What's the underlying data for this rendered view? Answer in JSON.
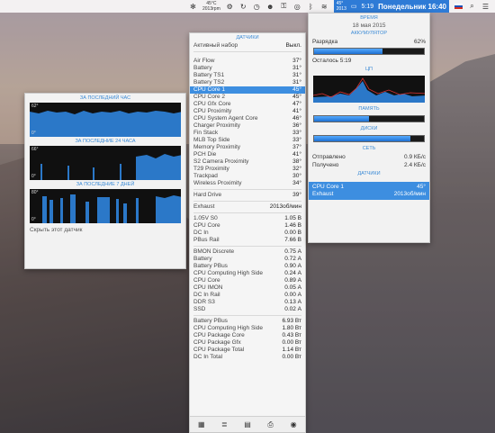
{
  "menubar": {
    "cpu_temp": "45°C",
    "rpm": "2013rpm",
    "status_temp": "45°",
    "status_rpm": "2013",
    "status_time": "5:19",
    "clock": "Понедельник 16:40"
  },
  "history": {
    "sections": [
      {
        "title": "ЗА ПОСЛЕДНИЙ ЧАС",
        "max": "62°",
        "min": "0°"
      },
      {
        "title": "ЗА ПОСЛЕДНИЕ 24 ЧАСА",
        "max": "66°",
        "min": "0°"
      },
      {
        "title": "ЗА ПОСЛЕДНИЕ 7 ДНЕЙ",
        "max": "80°",
        "min": "0°"
      }
    ],
    "hide_label": "Скрыть этот датчик"
  },
  "sensors": {
    "title": "ДАТЧИКИ",
    "active_set_label": "Активный набор",
    "active_set_value": "Выкл.",
    "temps": [
      {
        "name": "Air Flow",
        "value": "37°"
      },
      {
        "name": "Battery",
        "value": "31°"
      },
      {
        "name": "Battery TS1",
        "value": "31°"
      },
      {
        "name": "Battery TS2",
        "value": "31°"
      },
      {
        "name": "CPU Core 1",
        "value": "45°"
      },
      {
        "name": "CPU Core 2",
        "value": "45°"
      },
      {
        "name": "CPU Gfx Core",
        "value": "47°"
      },
      {
        "name": "CPU Proximity",
        "value": "41°"
      },
      {
        "name": "CPU System Agent Core",
        "value": "46°"
      },
      {
        "name": "Charger Proximity",
        "value": "36°"
      },
      {
        "name": "Fin Stack",
        "value": "33°"
      },
      {
        "name": "MLB Top Side",
        "value": "33°"
      },
      {
        "name": "Memory Proximity",
        "value": "37°"
      },
      {
        "name": "PCH Die",
        "value": "41°"
      },
      {
        "name": "S2 Camera Proximity",
        "value": "38°"
      },
      {
        "name": "T29 Proximity",
        "value": "32°"
      },
      {
        "name": "Trackpad",
        "value": "30°"
      },
      {
        "name": "Wireless Proximity",
        "value": "34°"
      }
    ],
    "drive": {
      "name": "Hard Drive",
      "value": "39°"
    },
    "fan": {
      "name": "Exhaust",
      "value": "2013об/мин"
    },
    "voltages": [
      {
        "name": "1.05V S0",
        "value": "1.05 В"
      },
      {
        "name": "CPU Core",
        "value": "1.46 В"
      },
      {
        "name": "DC In",
        "value": "0.00 В"
      },
      {
        "name": "PBus Rail",
        "value": "7.66 В"
      }
    ],
    "currents": [
      {
        "name": "BMON Discrete",
        "value": "0.75 А"
      },
      {
        "name": "Battery",
        "value": "0.72 А"
      },
      {
        "name": "Battery PBus",
        "value": "0.90 А"
      },
      {
        "name": "CPU Computing High Side",
        "value": "0.24 А"
      },
      {
        "name": "CPU Core",
        "value": "0.89 А"
      },
      {
        "name": "CPU IMON",
        "value": "0.05 А"
      },
      {
        "name": "DC In Rail",
        "value": "0.00 А"
      },
      {
        "name": "DDR S3",
        "value": "0.13 А"
      },
      {
        "name": "SSD",
        "value": "0.02 А"
      }
    ],
    "power": [
      {
        "name": "Battery PBus",
        "value": "6.93 Вт"
      },
      {
        "name": "CPU Computing High Side",
        "value": "1.80 Вт"
      },
      {
        "name": "CPU Package Core",
        "value": "0.43 Вт"
      },
      {
        "name": "CPU Package Gfx",
        "value": "0.00 Вт"
      },
      {
        "name": "CPU Package Total",
        "value": "1.14 Вт"
      },
      {
        "name": "DC In Total",
        "value": "0.00 Вт"
      }
    ]
  },
  "overview": {
    "time_title": "ВРЕМЯ",
    "date": "18 мая 2015",
    "battery_title": "АККУМУЛЯТОР",
    "discharge_label": "Разрядка",
    "discharge_value": "62%",
    "battery_level": 62,
    "remaining": "Осталось 5:19",
    "cpu_title": "ЦП",
    "memory_title": "ПАМЯТЬ",
    "memory_level": 50,
    "disks_title": "ДИСКИ",
    "disk_level": 88,
    "net_title": "СЕТЬ",
    "sent_label": "Отправлено",
    "sent_value": "0.9 КБ/с",
    "received_label": "Получено",
    "received_value": "2.4 КБ/с",
    "sensors_title": "ДАТЧИКИ",
    "sel_sensor_name": "CPU Core 1",
    "sel_sensor_value": "45°",
    "sel_fan_name": "Exhaust",
    "sel_fan_value": "2013об/мин"
  },
  "colors": {
    "accent": "#3d8ee0",
    "graph_fill": "#2b78c8"
  }
}
